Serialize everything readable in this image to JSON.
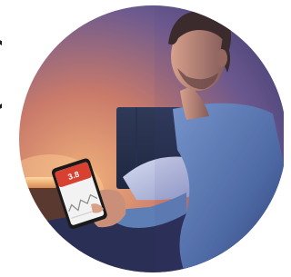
{
  "photo": {
    "phone_reading": "3.8",
    "colors": {
      "wall_warm": "#c97a6a",
      "wall_cool": "#6d5a8f",
      "headboard": "#2b3550",
      "pillow": "#b9c2e0",
      "shirt": "#5e7fb5",
      "skin": "#c98f78",
      "hair": "#3a2a24",
      "screen_red": "#d8412f",
      "screen_white": "#f2f2f2"
    }
  }
}
